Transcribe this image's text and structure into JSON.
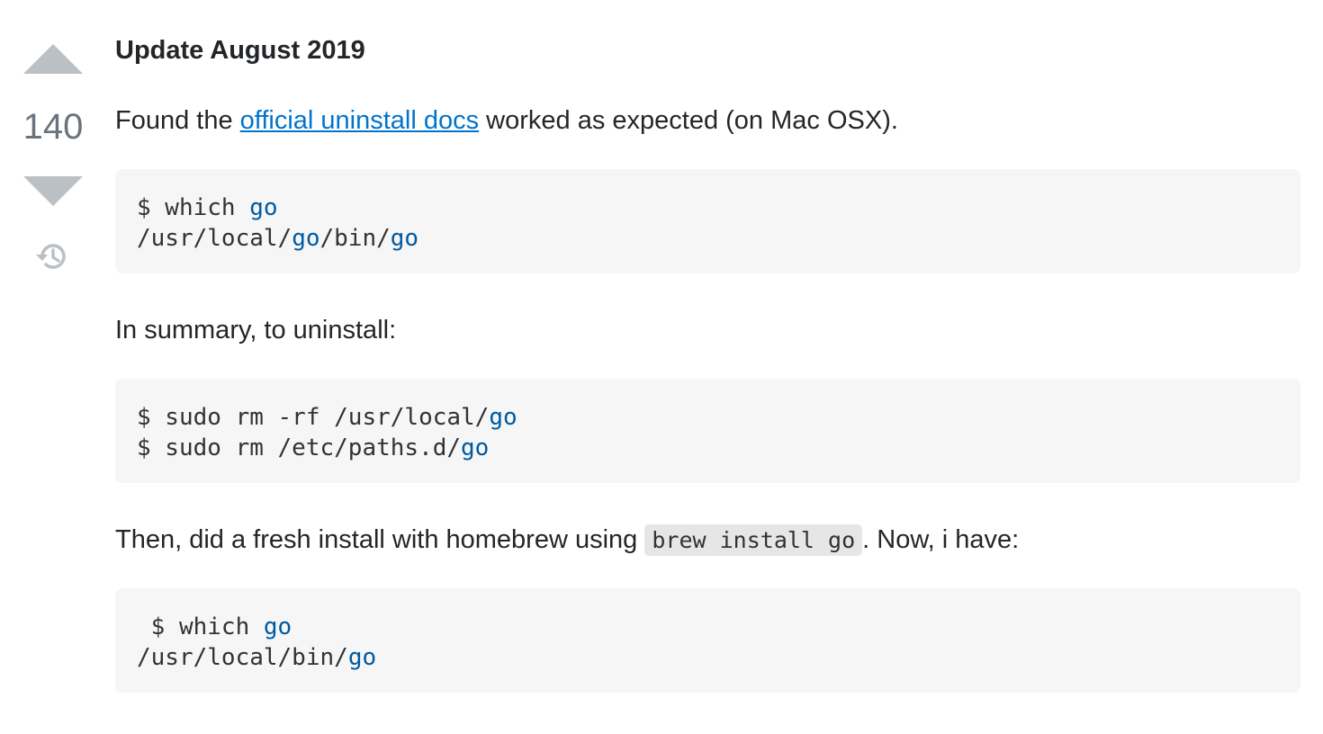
{
  "vote": {
    "score": "140",
    "upvote_label": "Upvote",
    "downvote_label": "Downvote",
    "history_label": "Show activity"
  },
  "post": {
    "heading": "Update August 2019",
    "p1": {
      "before": "Found the ",
      "link": "official uninstall docs",
      "after": " worked as expected (on Mac OSX)."
    },
    "code1": {
      "line1_a": "$ which ",
      "line1_kw": "go",
      "line2_a": "/usr/local/",
      "line2_kw1": "go",
      "line2_b": "/bin/",
      "line2_kw2": "go"
    },
    "p2": "In summary, to uninstall:",
    "code2": {
      "line1_a": "$ sudo rm -rf /usr/local/",
      "line1_kw": "go",
      "line2_a": "$ sudo rm /etc/paths.d/",
      "line2_kw": "go"
    },
    "p3": {
      "before": "Then, did a fresh install with homebrew using ",
      "inline_code": "brew install go",
      "after": ". Now, i have:"
    },
    "code3": {
      "line1_a": " $ which ",
      "line1_kw": "go",
      "line2_a": "/usr/local/bin/",
      "line2_kw": "go"
    }
  },
  "colors": {
    "link": "#0074cc",
    "code_keyword": "#005aa0",
    "code_bg": "#f6f6f6",
    "vote_arrow": "#bbc0c4"
  }
}
